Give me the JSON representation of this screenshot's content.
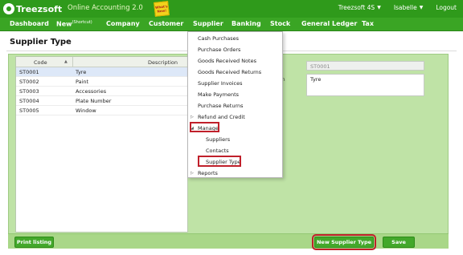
{
  "app": {
    "brand": "Treezsoft",
    "tagline": "Online Accounting 2.0",
    "whats_new": "What's New!"
  },
  "user_area": {
    "company": "Treezsoft 4S",
    "user": "Isabelle",
    "logout": "Logout"
  },
  "nav": [
    {
      "label": "Dashboard"
    },
    {
      "label": "New",
      "sup": "(Shortcut)"
    },
    {
      "label": "Company"
    },
    {
      "label": "Customer"
    },
    {
      "label": "Supplier"
    },
    {
      "label": "Banking"
    },
    {
      "label": "Stock"
    },
    {
      "label": "General Ledger"
    },
    {
      "label": "Tax"
    }
  ],
  "page": {
    "title": "Supplier Type"
  },
  "grid": {
    "columns": [
      "Code",
      "Description"
    ],
    "sort_indicator": "▲",
    "rows": [
      {
        "code": "ST0001",
        "description": "Tyre",
        "selected": true
      },
      {
        "code": "ST0002",
        "description": "Paint"
      },
      {
        "code": "ST0003",
        "description": "Accessories"
      },
      {
        "code": "ST0004",
        "description": "Plate Number"
      },
      {
        "code": "ST0005",
        "description": "Window"
      }
    ]
  },
  "form": {
    "code_label": "",
    "code_value": "ST0001",
    "description_label": "ption",
    "description_value": "Tyre"
  },
  "buttons": {
    "print_listing": "Print listing",
    "new_supplier_type": "New Supplier Type",
    "save": "Save"
  },
  "supplier_menu": {
    "items": [
      "Cash Purchases",
      "Purchase Orders",
      "Goods Received Notes",
      "Goods Received Returns",
      "Supplier Invoices",
      "Make Payments",
      "Purchase Returns",
      "Refund and Credit",
      "Manage",
      "Suppliers",
      "Contacts",
      "Supplier Type",
      "Reports"
    ]
  },
  "colors": {
    "header_green": "#2f9a1b",
    "nav_green": "#3aa524",
    "panel_green": "#bfe3a6",
    "button_green": "#43a82b",
    "highlight_red": "#c0202b"
  }
}
